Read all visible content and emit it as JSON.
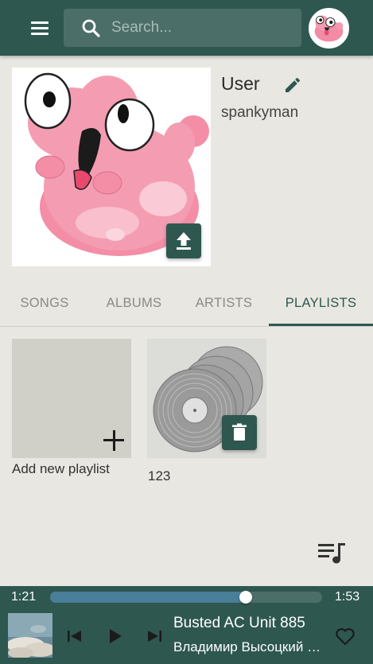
{
  "header": {
    "search_placeholder": "Search...",
    "menu_icon": "hamburger-menu-icon",
    "search_icon": "search-icon",
    "avatar": "user-avatar"
  },
  "profile": {
    "name": "User",
    "handle": "spankyman",
    "edit_icon": "pencil-icon",
    "upload_icon": "upload-icon"
  },
  "tabs": [
    {
      "label": "SONGS",
      "active": false
    },
    {
      "label": "ALBUMS",
      "active": false
    },
    {
      "label": "ARTISTS",
      "active": false
    },
    {
      "label": "PLAYLISTS",
      "active": true
    }
  ],
  "playlists": {
    "add_label": "Add new playlist",
    "items": [
      {
        "name": "123",
        "icon": "vinyl-records-icon"
      }
    ],
    "delete_icon": "trash-icon"
  },
  "queue_icon": "queue-music-icon",
  "player": {
    "elapsed": "1:21",
    "duration": "1:53",
    "progress": 0.72,
    "title": "Busted AC Unit 885",
    "artist": "Владимир Высоцкий - Парус",
    "icons": [
      "skip-previous-icon",
      "play-icon",
      "skip-next-icon",
      "heart-outline-icon"
    ]
  },
  "colors": {
    "primary": "#2e5750",
    "background": "#e8e7e1",
    "progress": "#4a7f9a"
  }
}
